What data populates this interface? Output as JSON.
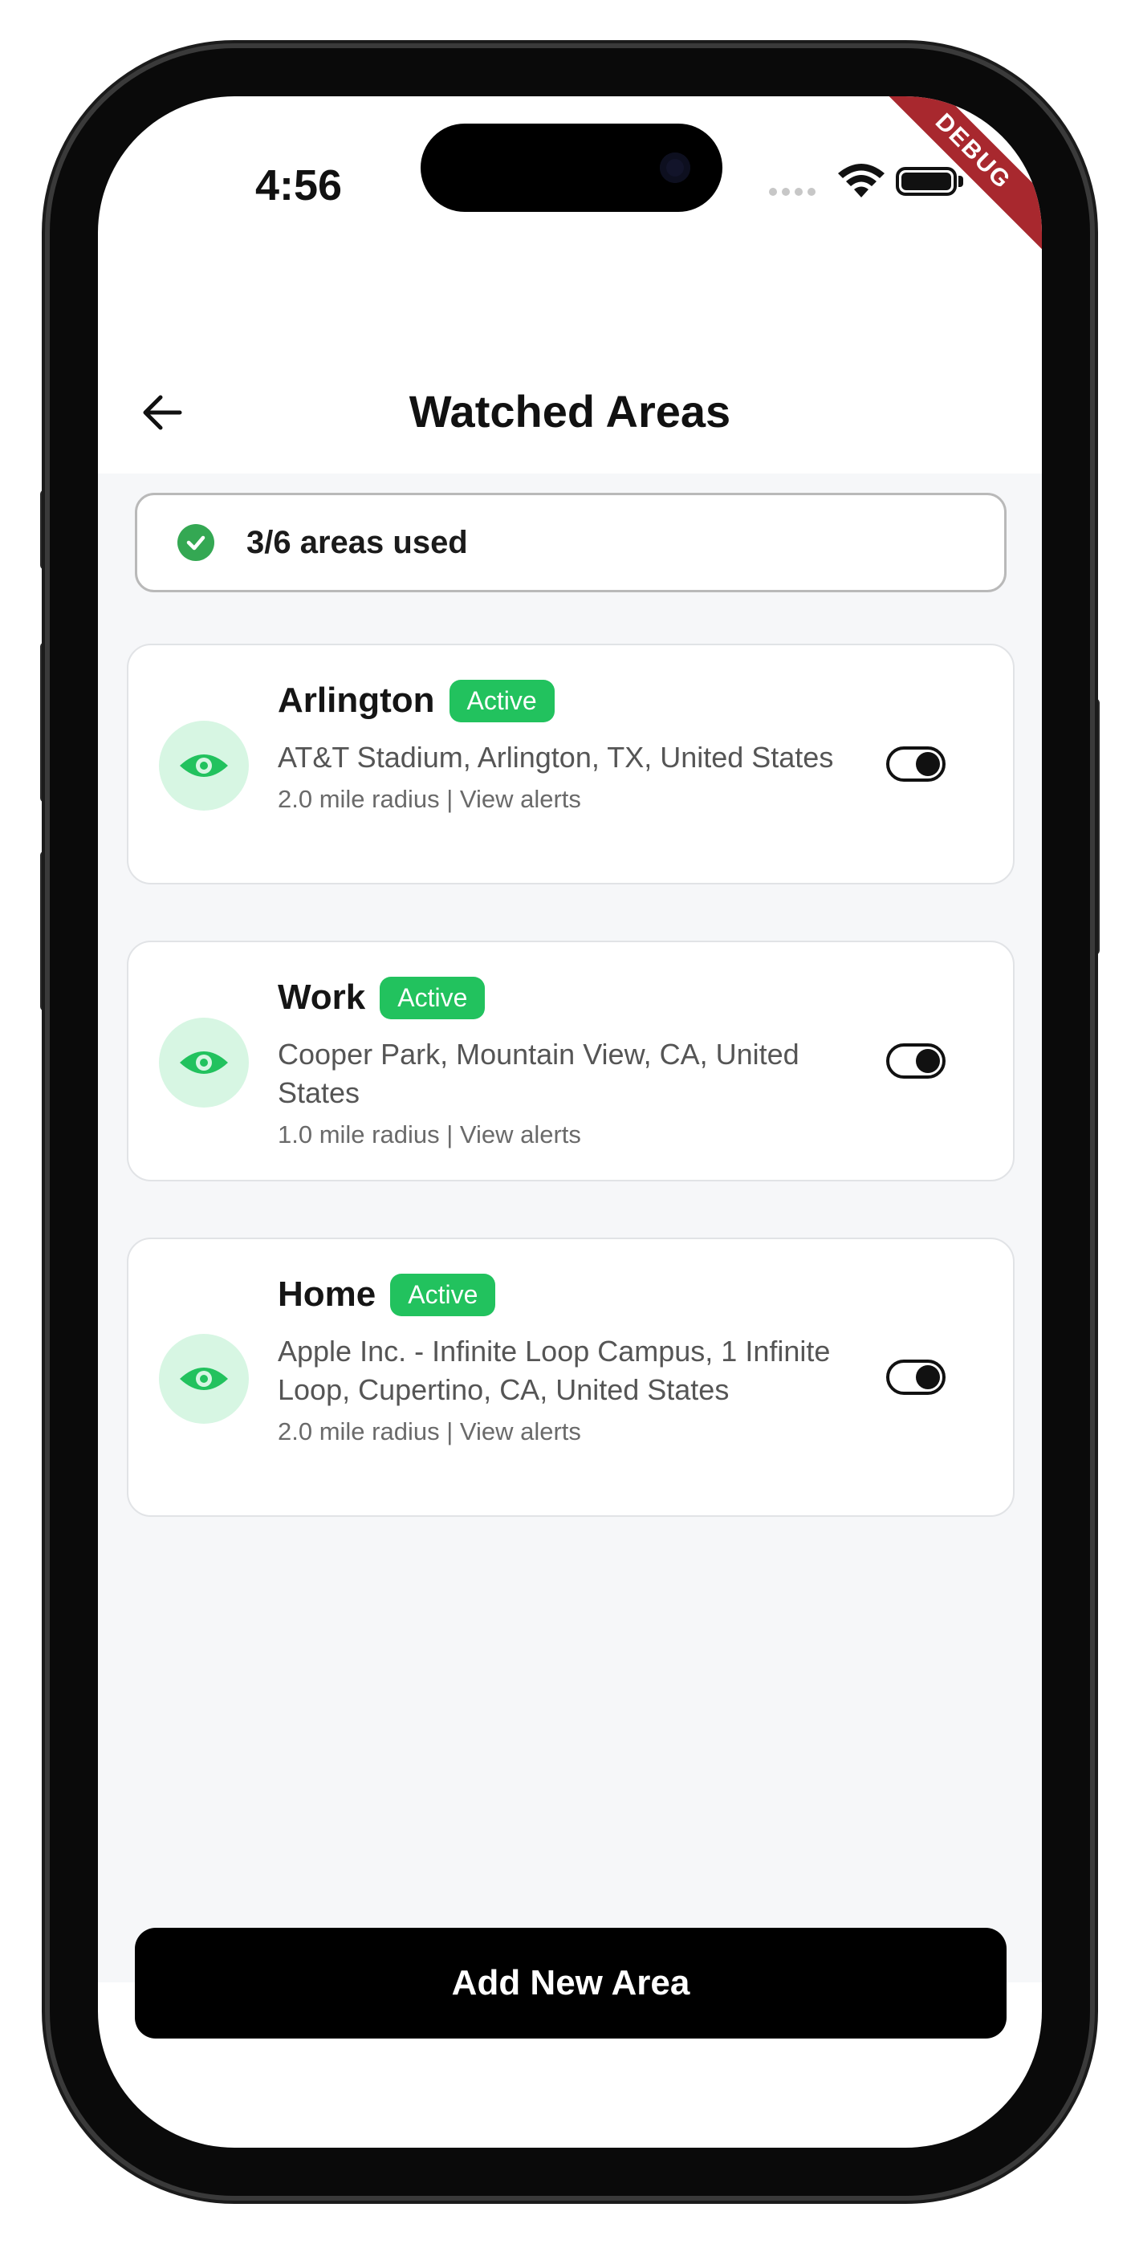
{
  "status_bar": {
    "time": "4:56",
    "debug_label": "DEBUG"
  },
  "header": {
    "title": "Watched Areas"
  },
  "usage": {
    "text": "3/6 areas used"
  },
  "areas": [
    {
      "name": "Arlington",
      "status": "Active",
      "address": "AT&T Stadium, Arlington, TX, United States",
      "meta": "2.0 mile radius | View alerts",
      "enabled": true
    },
    {
      "name": "Work",
      "status": "Active",
      "address": "Cooper Park, Mountain View, CA, United States",
      "meta": "1.0 mile radius | View alerts",
      "enabled": true
    },
    {
      "name": "Home",
      "status": "Active",
      "address": "Apple Inc. - Infinite Loop Campus, 1 Infinite Loop, Cupertino, CA, United States",
      "meta": "2.0 mile radius | View alerts",
      "enabled": true
    }
  ],
  "footer": {
    "add_label": "Add New Area"
  },
  "colors": {
    "accent_green": "#22c25e",
    "icon_bg": "#d7f6e3",
    "button_bg": "#000000"
  }
}
